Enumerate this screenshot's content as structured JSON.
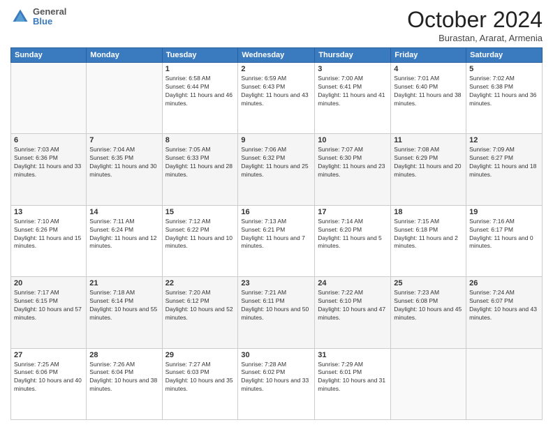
{
  "header": {
    "logo": {
      "general": "General",
      "blue": "Blue"
    },
    "title": "October 2024",
    "subtitle": "Burastan, Ararat, Armenia"
  },
  "days_of_week": [
    "Sunday",
    "Monday",
    "Tuesday",
    "Wednesday",
    "Thursday",
    "Friday",
    "Saturday"
  ],
  "weeks": [
    [
      {
        "day": "",
        "info": ""
      },
      {
        "day": "",
        "info": ""
      },
      {
        "day": "1",
        "info": "Sunrise: 6:58 AM\nSunset: 6:44 PM\nDaylight: 11 hours and 46 minutes."
      },
      {
        "day": "2",
        "info": "Sunrise: 6:59 AM\nSunset: 6:43 PM\nDaylight: 11 hours and 43 minutes."
      },
      {
        "day": "3",
        "info": "Sunrise: 7:00 AM\nSunset: 6:41 PM\nDaylight: 11 hours and 41 minutes."
      },
      {
        "day": "4",
        "info": "Sunrise: 7:01 AM\nSunset: 6:40 PM\nDaylight: 11 hours and 38 minutes."
      },
      {
        "day": "5",
        "info": "Sunrise: 7:02 AM\nSunset: 6:38 PM\nDaylight: 11 hours and 36 minutes."
      }
    ],
    [
      {
        "day": "6",
        "info": "Sunrise: 7:03 AM\nSunset: 6:36 PM\nDaylight: 11 hours and 33 minutes."
      },
      {
        "day": "7",
        "info": "Sunrise: 7:04 AM\nSunset: 6:35 PM\nDaylight: 11 hours and 30 minutes."
      },
      {
        "day": "8",
        "info": "Sunrise: 7:05 AM\nSunset: 6:33 PM\nDaylight: 11 hours and 28 minutes."
      },
      {
        "day": "9",
        "info": "Sunrise: 7:06 AM\nSunset: 6:32 PM\nDaylight: 11 hours and 25 minutes."
      },
      {
        "day": "10",
        "info": "Sunrise: 7:07 AM\nSunset: 6:30 PM\nDaylight: 11 hours and 23 minutes."
      },
      {
        "day": "11",
        "info": "Sunrise: 7:08 AM\nSunset: 6:29 PM\nDaylight: 11 hours and 20 minutes."
      },
      {
        "day": "12",
        "info": "Sunrise: 7:09 AM\nSunset: 6:27 PM\nDaylight: 11 hours and 18 minutes."
      }
    ],
    [
      {
        "day": "13",
        "info": "Sunrise: 7:10 AM\nSunset: 6:26 PM\nDaylight: 11 hours and 15 minutes."
      },
      {
        "day": "14",
        "info": "Sunrise: 7:11 AM\nSunset: 6:24 PM\nDaylight: 11 hours and 12 minutes."
      },
      {
        "day": "15",
        "info": "Sunrise: 7:12 AM\nSunset: 6:22 PM\nDaylight: 11 hours and 10 minutes."
      },
      {
        "day": "16",
        "info": "Sunrise: 7:13 AM\nSunset: 6:21 PM\nDaylight: 11 hours and 7 minutes."
      },
      {
        "day": "17",
        "info": "Sunrise: 7:14 AM\nSunset: 6:20 PM\nDaylight: 11 hours and 5 minutes."
      },
      {
        "day": "18",
        "info": "Sunrise: 7:15 AM\nSunset: 6:18 PM\nDaylight: 11 hours and 2 minutes."
      },
      {
        "day": "19",
        "info": "Sunrise: 7:16 AM\nSunset: 6:17 PM\nDaylight: 11 hours and 0 minutes."
      }
    ],
    [
      {
        "day": "20",
        "info": "Sunrise: 7:17 AM\nSunset: 6:15 PM\nDaylight: 10 hours and 57 minutes."
      },
      {
        "day": "21",
        "info": "Sunrise: 7:18 AM\nSunset: 6:14 PM\nDaylight: 10 hours and 55 minutes."
      },
      {
        "day": "22",
        "info": "Sunrise: 7:20 AM\nSunset: 6:12 PM\nDaylight: 10 hours and 52 minutes."
      },
      {
        "day": "23",
        "info": "Sunrise: 7:21 AM\nSunset: 6:11 PM\nDaylight: 10 hours and 50 minutes."
      },
      {
        "day": "24",
        "info": "Sunrise: 7:22 AM\nSunset: 6:10 PM\nDaylight: 10 hours and 47 minutes."
      },
      {
        "day": "25",
        "info": "Sunrise: 7:23 AM\nSunset: 6:08 PM\nDaylight: 10 hours and 45 minutes."
      },
      {
        "day": "26",
        "info": "Sunrise: 7:24 AM\nSunset: 6:07 PM\nDaylight: 10 hours and 43 minutes."
      }
    ],
    [
      {
        "day": "27",
        "info": "Sunrise: 7:25 AM\nSunset: 6:06 PM\nDaylight: 10 hours and 40 minutes."
      },
      {
        "day": "28",
        "info": "Sunrise: 7:26 AM\nSunset: 6:04 PM\nDaylight: 10 hours and 38 minutes."
      },
      {
        "day": "29",
        "info": "Sunrise: 7:27 AM\nSunset: 6:03 PM\nDaylight: 10 hours and 35 minutes."
      },
      {
        "day": "30",
        "info": "Sunrise: 7:28 AM\nSunset: 6:02 PM\nDaylight: 10 hours and 33 minutes."
      },
      {
        "day": "31",
        "info": "Sunrise: 7:29 AM\nSunset: 6:01 PM\nDaylight: 10 hours and 31 minutes."
      },
      {
        "day": "",
        "info": ""
      },
      {
        "day": "",
        "info": ""
      }
    ]
  ]
}
